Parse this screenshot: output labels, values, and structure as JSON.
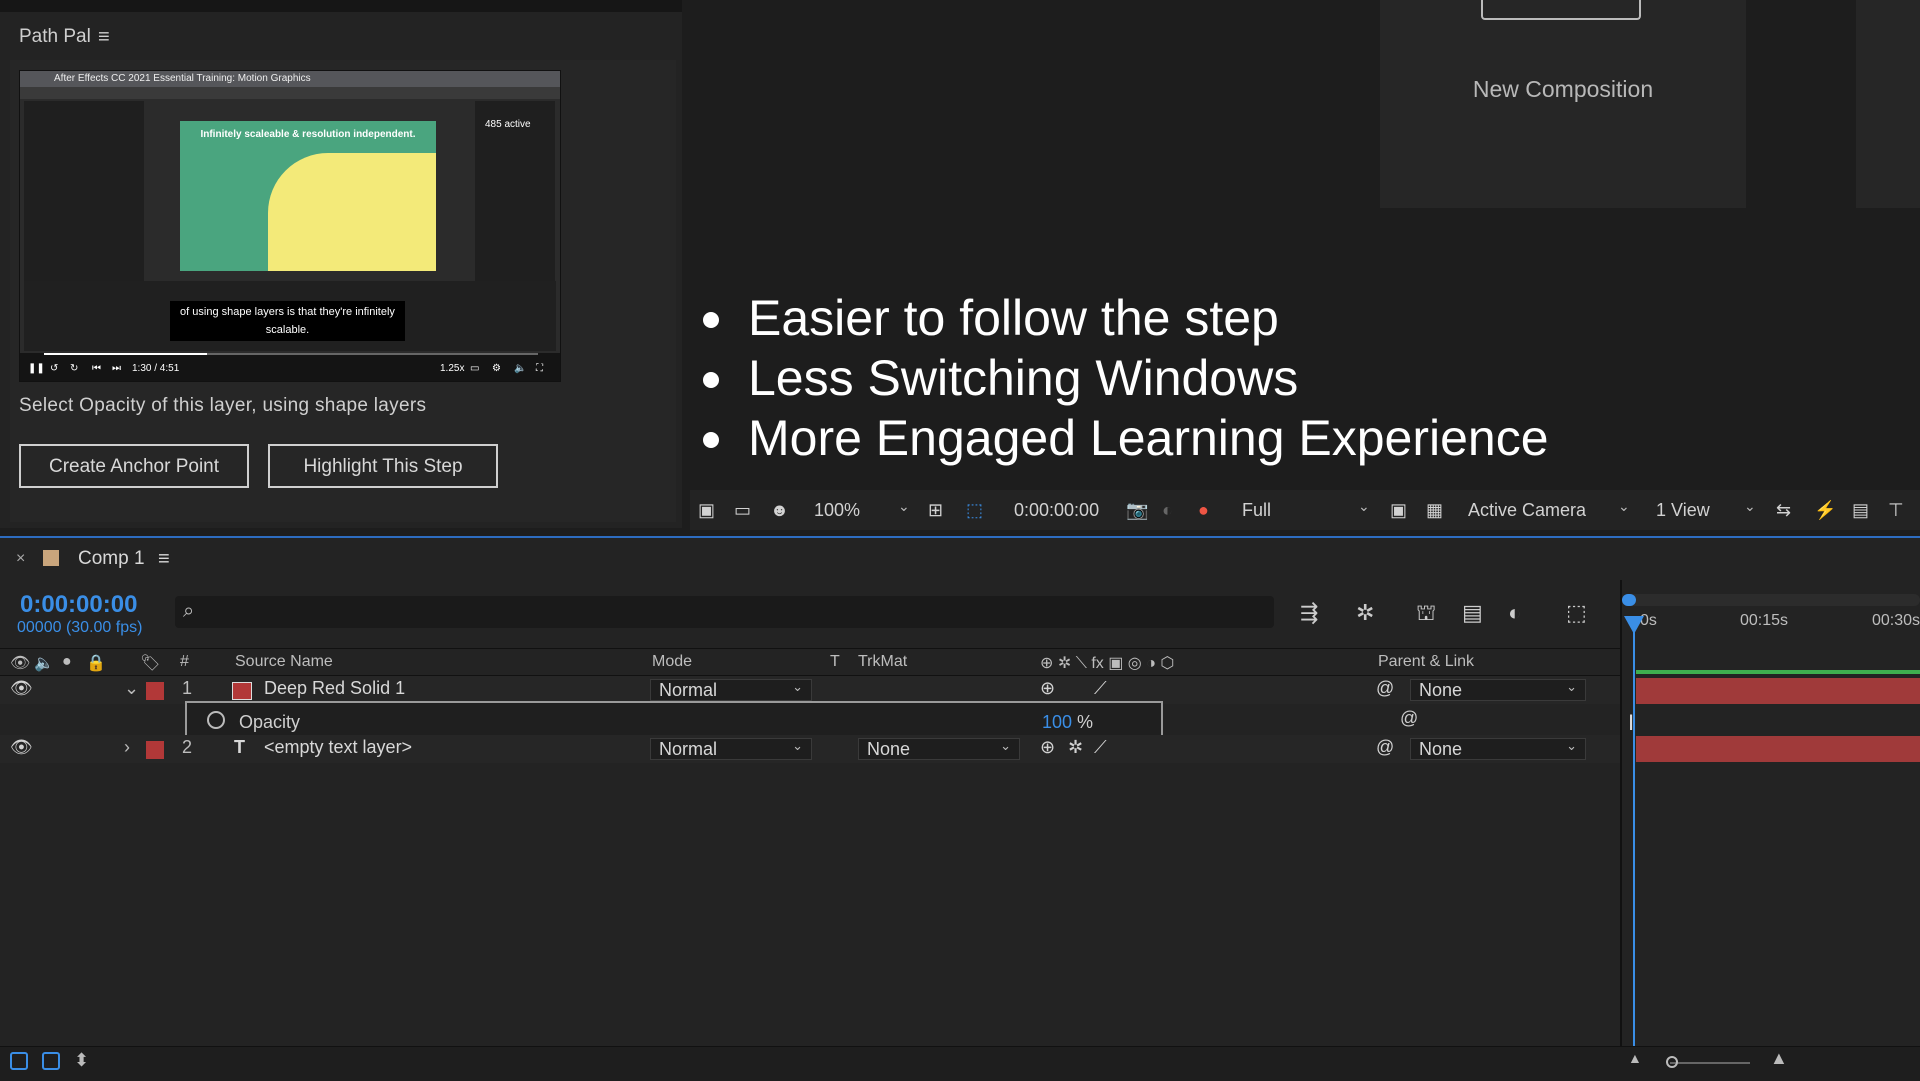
{
  "path_pal": {
    "title": "Path Pal",
    "menu_icon": "hamburger-icon",
    "video": {
      "window_title": "After Effects CC 2021 Essential Training: Motion Graphics",
      "green_text": "Infinitely scaleable & resolution independent.",
      "active_count": "485 active",
      "caption_line1": "of using shape layers is that they're infinitely",
      "caption_line2": "scalable.",
      "time": "1:30 / 4:51",
      "speed": "1.25x",
      "progress": 0.33
    },
    "description": "Select Opacity of this layer, using shape layers",
    "buttons": [
      "Create Anchor Point",
      "Highlight This Step"
    ]
  },
  "new_composition": {
    "label": "New Composition"
  },
  "bullets": [
    "Easier to follow the step",
    "Less Switching Windows",
    "More Engaged Learning Experience"
  ],
  "viewer_toolbar": {
    "zoom": "100%",
    "timecode": "0:00:00:00",
    "resolution": "Full",
    "camera": "Active Camera",
    "views": "1 View"
  },
  "timeline": {
    "tab": "Comp 1",
    "current_time": "0:00:00:00",
    "frames": "00000 (30.00 fps)",
    "columns": {
      "num": "#",
      "source": "Source Name",
      "mode": "Mode",
      "t": "T",
      "trkmat": "TrkMat",
      "parent": "Parent & Link"
    },
    "layers": [
      {
        "num": "1",
        "name": "Deep Red Solid 1",
        "mode": "Normal",
        "trkmat": "",
        "parent": "None",
        "color": "#b23838"
      },
      {
        "num": "2",
        "name": "<empty text layer>",
        "mode": "Normal",
        "trkmat": "None",
        "parent": "None",
        "color": "#b23838"
      }
    ],
    "opacity": {
      "label": "Opacity",
      "value": "100",
      "unit": "%"
    },
    "ruler_ticks": [
      "0s",
      "00:15s",
      "00:30s"
    ]
  }
}
